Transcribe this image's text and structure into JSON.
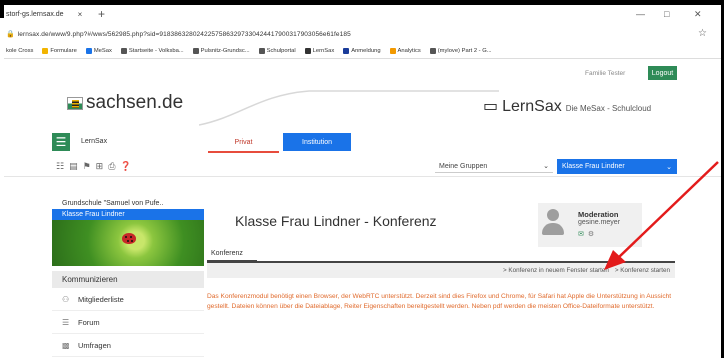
{
  "browser": {
    "tab_title": "storf-gs.lernsax.de",
    "tab_close": "×",
    "new_tab": "+",
    "url": "lernsax.de/www/9.php?#/wws/562985.php?sid=91838632802422575863297330424417900317903056e61fe185",
    "bookmarks": [
      {
        "label": "kole Cross",
        "icon_color": ""
      },
      {
        "label": "Formulare",
        "icon_color": "#f2b400"
      },
      {
        "label": "MeSax",
        "icon_color": "#1a73e8"
      },
      {
        "label": "Startseite - Volksba...",
        "icon_color": "#555555"
      },
      {
        "label": "Pulsnitz-Grundsc...",
        "icon_color": "#555555"
      },
      {
        "label": "Schulportal",
        "icon_color": "#555555"
      },
      {
        "label": "LernSax",
        "icon_color": "#333333"
      },
      {
        "label": "Anmeldung",
        "icon_color": "#1a3c9a"
      },
      {
        "label": "Analytics",
        "icon_color": "#f29900"
      },
      {
        "label": "(mylove) Part 2 - G...",
        "icon_color": "#555555"
      }
    ]
  },
  "header": {
    "user_name": "Familie Tester",
    "logout_label": "Logout",
    "sachsen_brand": "sachsen.de",
    "lernsax_brand": "LernSax",
    "lernsax_tagline": "Die MeSax - Schulcloud"
  },
  "nav": {
    "menu_label": "LernSax",
    "tab_privat": "Privat",
    "tab_institution": "Institution"
  },
  "toolbar": {
    "group_select": "Meine Gruppen",
    "class_select": "Klasse Frau Lindner"
  },
  "sidebar": {
    "school": "Grundschule \"Samuel von Pufe..",
    "active_class": "Klasse Frau Lindner",
    "section": "Kommunizieren",
    "items": [
      {
        "label": "Mitgliederliste",
        "icon": "members-icon"
      },
      {
        "label": "Forum",
        "icon": "forum-icon"
      },
      {
        "label": "Umfragen",
        "icon": "poll-icon"
      }
    ]
  },
  "main": {
    "title": "Klasse Frau Lindner - Konferenz",
    "moderation_title": "Moderation",
    "moderator": "gesine.meyer",
    "tab_konferenz": "Konferenz",
    "action_new_window": "> Konferenz in neuem Fenster starten",
    "action_start": "> Konferenz starten",
    "notice": "Das Konferenzmodul benötigt einen Browser, der WebRTC unterstützt. Derzeit sind dies Firefox und Chrome, für Safari hat Apple die Unterstützung in Aussicht gestellt. Dateien können über die Dateiablage, Reiter Eigenschaften bereitgestellt werden. Neben pdf werden die meisten Office-Dateiformate unterstützt."
  },
  "colors": {
    "green": "#2e8b57",
    "blue": "#1a73e8",
    "annotation_arrow": "#e31b1b",
    "notice_text": "#e06a2c"
  }
}
